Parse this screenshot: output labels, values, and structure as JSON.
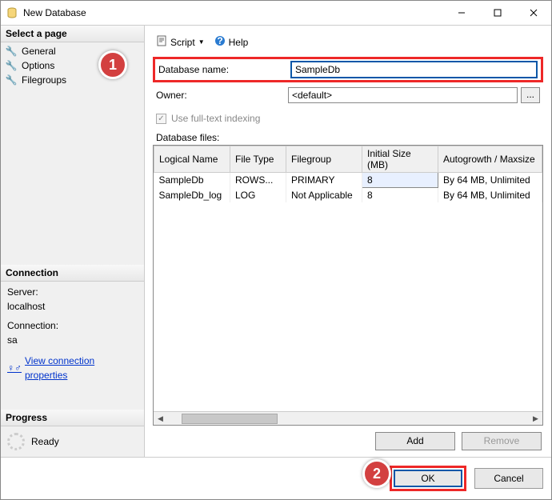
{
  "window": {
    "title": "New Database"
  },
  "sidebar": {
    "select_page_header": "Select a page",
    "pages": [
      {
        "label": "General"
      },
      {
        "label": "Options"
      },
      {
        "label": "Filegroups"
      }
    ],
    "connection_header": "Connection",
    "server_label": "Server:",
    "server_value": "localhost",
    "connection_label": "Connection:",
    "connection_value": "sa",
    "view_props": "View connection properties",
    "progress_header": "Progress",
    "progress_status": "Ready"
  },
  "toolbar": {
    "script": "Script",
    "help": "Help"
  },
  "form": {
    "db_name_label": "Database name:",
    "db_name_value": "SampleDb",
    "owner_label": "Owner:",
    "owner_value": "<default>",
    "fulltext_label": "Use full-text indexing"
  },
  "files": {
    "label": "Database files:",
    "columns": [
      "Logical Name",
      "File Type",
      "Filegroup",
      "Initial Size (MB)",
      "Autogrowth / Maxsize"
    ],
    "rows": [
      {
        "name": "SampleDb",
        "type": "ROWS...",
        "fg": "PRIMARY",
        "size": "8",
        "growth": "By 64 MB, Unlimited"
      },
      {
        "name": "SampleDb_log",
        "type": "LOG",
        "fg": "Not Applicable",
        "size": "8",
        "growth": "By 64 MB, Unlimited"
      }
    ]
  },
  "buttons": {
    "add": "Add",
    "remove": "Remove",
    "ok": "OK",
    "cancel": "Cancel"
  },
  "callouts": {
    "one": "1",
    "two": "2"
  }
}
